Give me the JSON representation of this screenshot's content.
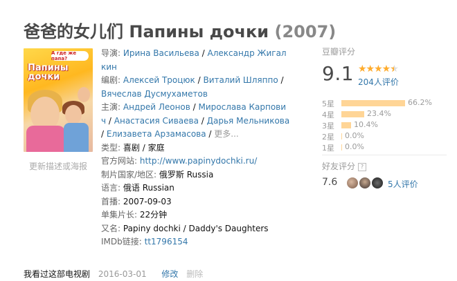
{
  "title": {
    "main": "爸爸的女儿们 Папины дочки",
    "year": "(2007)"
  },
  "poster": {
    "bubble_text": "А где же папа?",
    "title_text": "Папины дочки"
  },
  "update_link": "更新描述或海报",
  "info": {
    "director_label": "导演:",
    "directors": [
      "Ирина Васильева",
      "Александр Жигалкин"
    ],
    "director_line1": "Александр Жигал",
    "director_line2": "кин",
    "writer_label": "编剧:",
    "writers": [
      "Алексей Троцюк",
      "Виталий Шляппо",
      "Вячеслав Дусмухаметов"
    ],
    "cast_label": "主演:",
    "cast_line1_a": "Андрей Леонов",
    "cast_line1_b": "Мирослава Карпови",
    "cast_line2_a": "ч",
    "cast_line2_b": "Анастасия Сиваева",
    "cast_line2_c": "Дарья Мельникова",
    "cast_line3_a": "Елизавета Арзамасова",
    "more": "更多...",
    "genre_label": "类型:",
    "genres": [
      "喜剧",
      "家庭"
    ],
    "website_label": "官方网站:",
    "website": "http://www.papinydochki.ru/",
    "country_label": "制片国家/地区:",
    "country": "俄罗斯 Russia",
    "language_label": "语言:",
    "language": "俄语 Russian",
    "premiere_label": "首播:",
    "premiere": "2007-09-03",
    "runtime_label": "单集片长:",
    "runtime": "22分钟",
    "aka_label": "又名:",
    "aka": "Papiny dochki / Daddy's Daughters",
    "imdb_label": "IMDb链接:",
    "imdb": "tt1796154"
  },
  "rating": {
    "label": "豆瓣评分",
    "score": "9.1",
    "stars_filled": 4.5,
    "people": "204人评价",
    "distribution": [
      {
        "label": "5星",
        "percent": 66.2,
        "text": "66.2%"
      },
      {
        "label": "4星",
        "percent": 23.4,
        "text": "23.4%"
      },
      {
        "label": "3星",
        "percent": 10.4,
        "text": "10.4%"
      },
      {
        "label": "2星",
        "percent": 0.0,
        "text": "0.0%"
      },
      {
        "label": "1星",
        "percent": 0.0,
        "text": "0.0%"
      }
    ],
    "friend_label": "好友评分",
    "friend_help": "?",
    "friend_score": "7.6",
    "friend_people": "5人评价"
  },
  "footer": {
    "status": "我看过这部电视剧",
    "date": "2016-03-01",
    "edit": "修改",
    "delete": "删除"
  },
  "colors": {
    "link": "#3377aa",
    "bar": "#ffd596",
    "star": "#ffac2d"
  }
}
